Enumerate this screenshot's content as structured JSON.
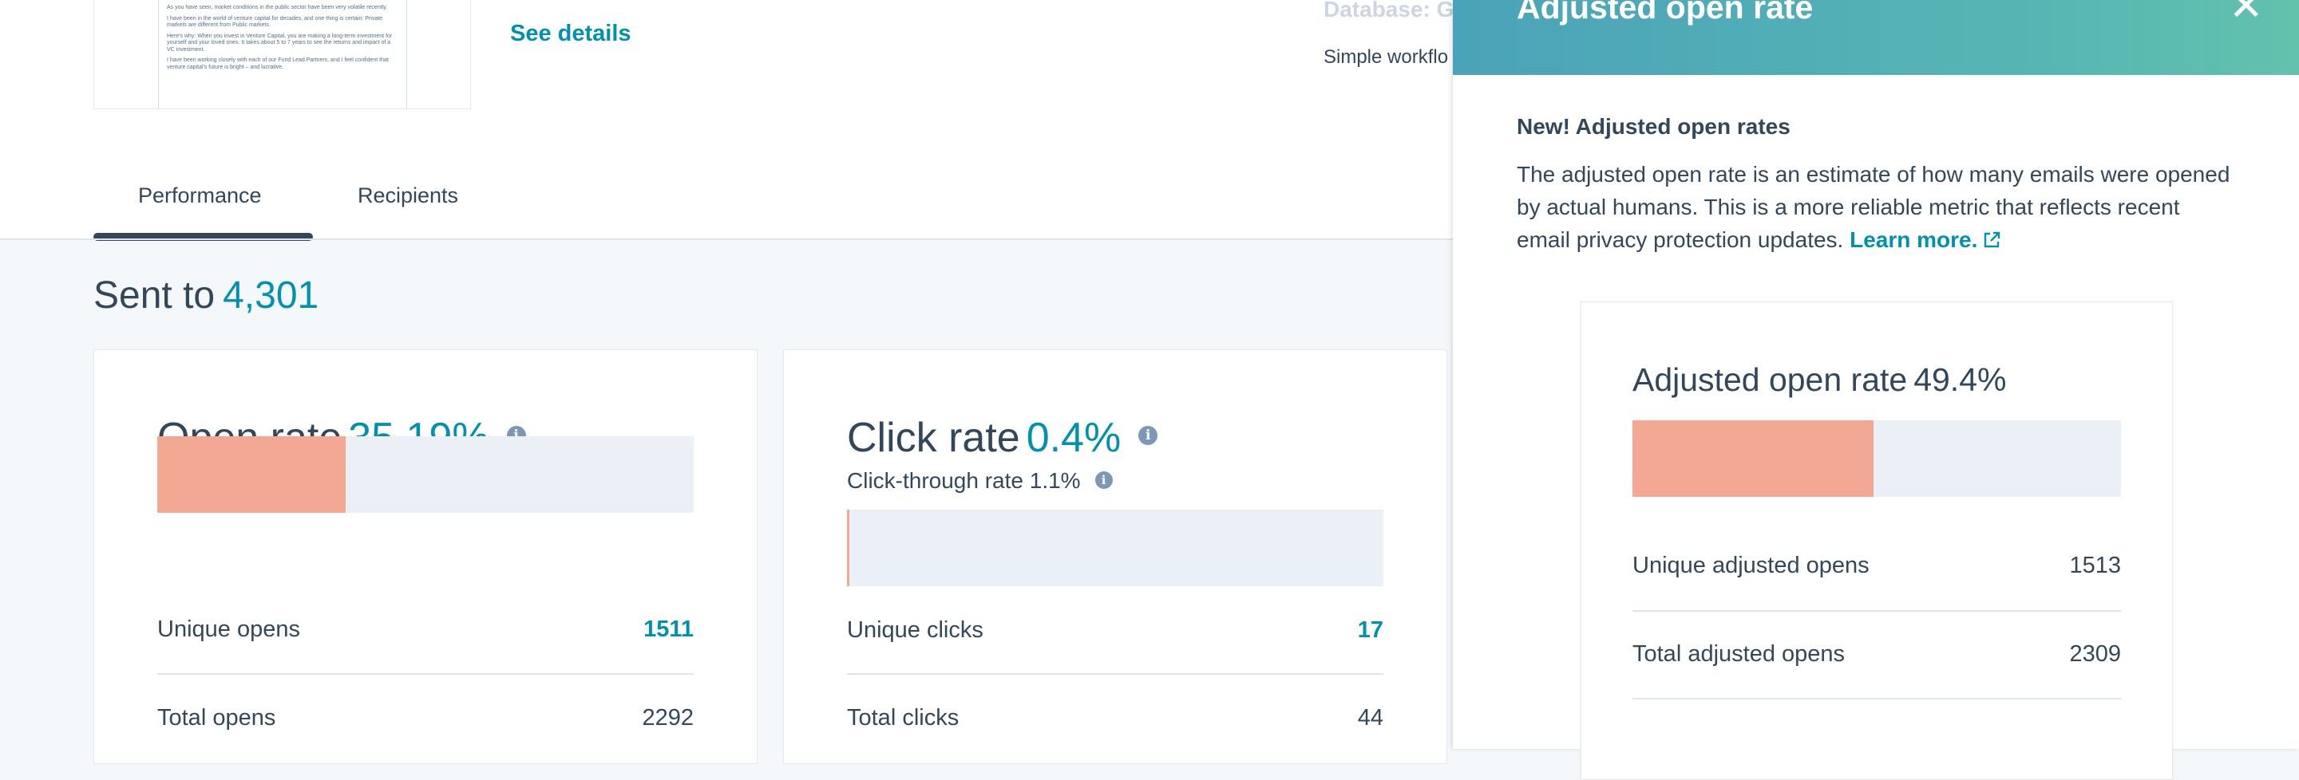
{
  "email_preview": {
    "paragraphs": [
      "As you have seen, market conditions in the public sector have been very volatile recently.",
      "I have been in the world of venture capital for decades, and one thing is certain: Private markets are different from Public markets.",
      "Here's why: When you invest in Venture Capital, you are making a long-term investment for yourself and your loved ones. It takes about 5 to 7 years to see the returns and impact of a VC investment.",
      "I have been working closely with each of our Fund Lead Partners, and I feel confident that venture capital's future is bright – and lucrative."
    ],
    "see_details_label": "See details"
  },
  "header_meta": {
    "database_label": "Database: G",
    "workflow_label": "Simple workflo"
  },
  "tabs": [
    {
      "label": "Performance",
      "active": true
    },
    {
      "label": "Recipients",
      "active": false
    }
  ],
  "sent_to": {
    "label": "Sent to",
    "value": "4,301"
  },
  "open_card": {
    "title": "Open rate",
    "rate": "35.19%",
    "rate_fraction": 0.3519,
    "rows": [
      {
        "label": "Unique opens",
        "value": "1511"
      },
      {
        "label": "Total opens",
        "value": "2292"
      }
    ]
  },
  "click_card": {
    "title": "Click rate",
    "rate": "0.4%",
    "rate_fraction": 0.004,
    "ctr_label": "Click-through rate 1.1%",
    "rows": [
      {
        "label": "Unique clicks",
        "value": "17"
      },
      {
        "label": "Total clicks",
        "value": "44"
      }
    ]
  },
  "panel": {
    "title": "Adjusted open rate",
    "subtitle": "New! Adjusted open rates",
    "description": "The adjusted open rate is an estimate of how many emails were opened by actual humans. This is a more reliable metric that reflects recent email privacy protection updates.",
    "learn_more": "Learn more.",
    "card": {
      "title": "Adjusted open rate",
      "rate": "49.4%",
      "rate_fraction": 0.494,
      "rows": [
        {
          "label": "Unique adjusted opens",
          "value": "1513"
        },
        {
          "label": "Total adjusted opens",
          "value": "2309"
        }
      ]
    }
  },
  "colors": {
    "accent": "#0091ae",
    "bar_fill": "#f2a893",
    "bar_track": "#eaf0f6",
    "text": "#33475b"
  }
}
